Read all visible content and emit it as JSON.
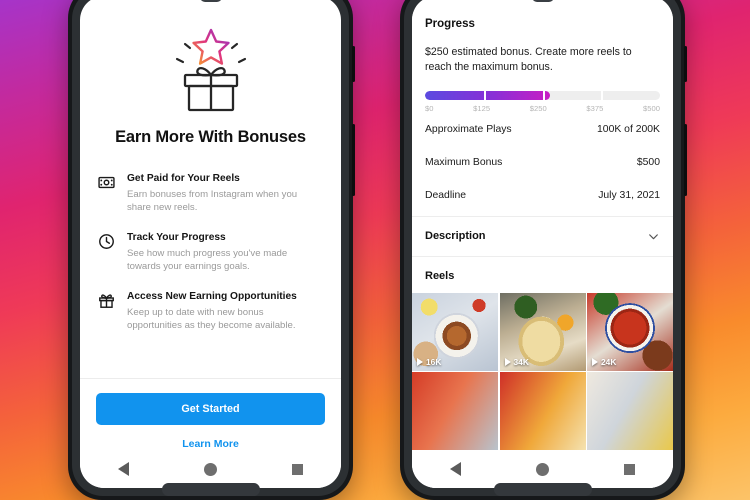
{
  "background": {
    "gradient_from": "#a634c9",
    "gradient_mid": "#e0246f",
    "gradient_to": "#fcc368"
  },
  "left_phone": {
    "hero": {
      "icon": "gift-box-with-star-icon",
      "title": "Earn More With Bonuses"
    },
    "features": [
      {
        "icon": "money-bill-icon",
        "title": "Get Paid for Your Reels",
        "description": "Earn bonuses from Instagram when you share new reels."
      },
      {
        "icon": "clock-icon",
        "title": "Track Your Progress",
        "description": "See how much progress you've made towards your earnings goals."
      },
      {
        "icon": "gift-icon",
        "title": "Access New Earning Opportunities",
        "description": "Keep up to date with new bonus opportunities as they become available."
      }
    ],
    "cta": {
      "primary_label": "Get Started",
      "primary_color": "#1193ee",
      "secondary_label": "Learn More",
      "secondary_color": "#1193ee"
    },
    "nav": {
      "back": "back-button",
      "home": "home-button",
      "recents": "recents-button"
    }
  },
  "right_phone": {
    "progress": {
      "heading": "Progress",
      "summary": "$250 estimated bonus. Create more reels to reach the maximum bonus.",
      "bar": {
        "fill_percent": 53,
        "gradient_from": "#5b4ae0",
        "gradient_to": "#c81ec4",
        "labels": [
          "$0",
          "$125",
          "$250",
          "$375",
          "$500"
        ]
      }
    },
    "stats": [
      {
        "label": "Approximate Plays",
        "value": "100K of 200K"
      },
      {
        "label": "Maximum Bonus",
        "value": "$500"
      },
      {
        "label": "Deadline",
        "value": "July 31, 2021"
      }
    ],
    "description_section": {
      "label": "Description",
      "icon": "chevron-down-icon"
    },
    "reels_section": {
      "label": "Reels",
      "items": [
        {
          "plays": "16K",
          "thumb": "food-a"
        },
        {
          "plays": "34K",
          "thumb": "food-b"
        },
        {
          "plays": "24K",
          "thumb": "food-c"
        },
        {
          "plays": "",
          "thumb": "food-d"
        },
        {
          "plays": "",
          "thumb": "food-e"
        },
        {
          "plays": "",
          "thumb": "food-f"
        }
      ]
    },
    "nav": {
      "back": "back-button",
      "home": "home-button",
      "recents": "recents-button"
    }
  }
}
